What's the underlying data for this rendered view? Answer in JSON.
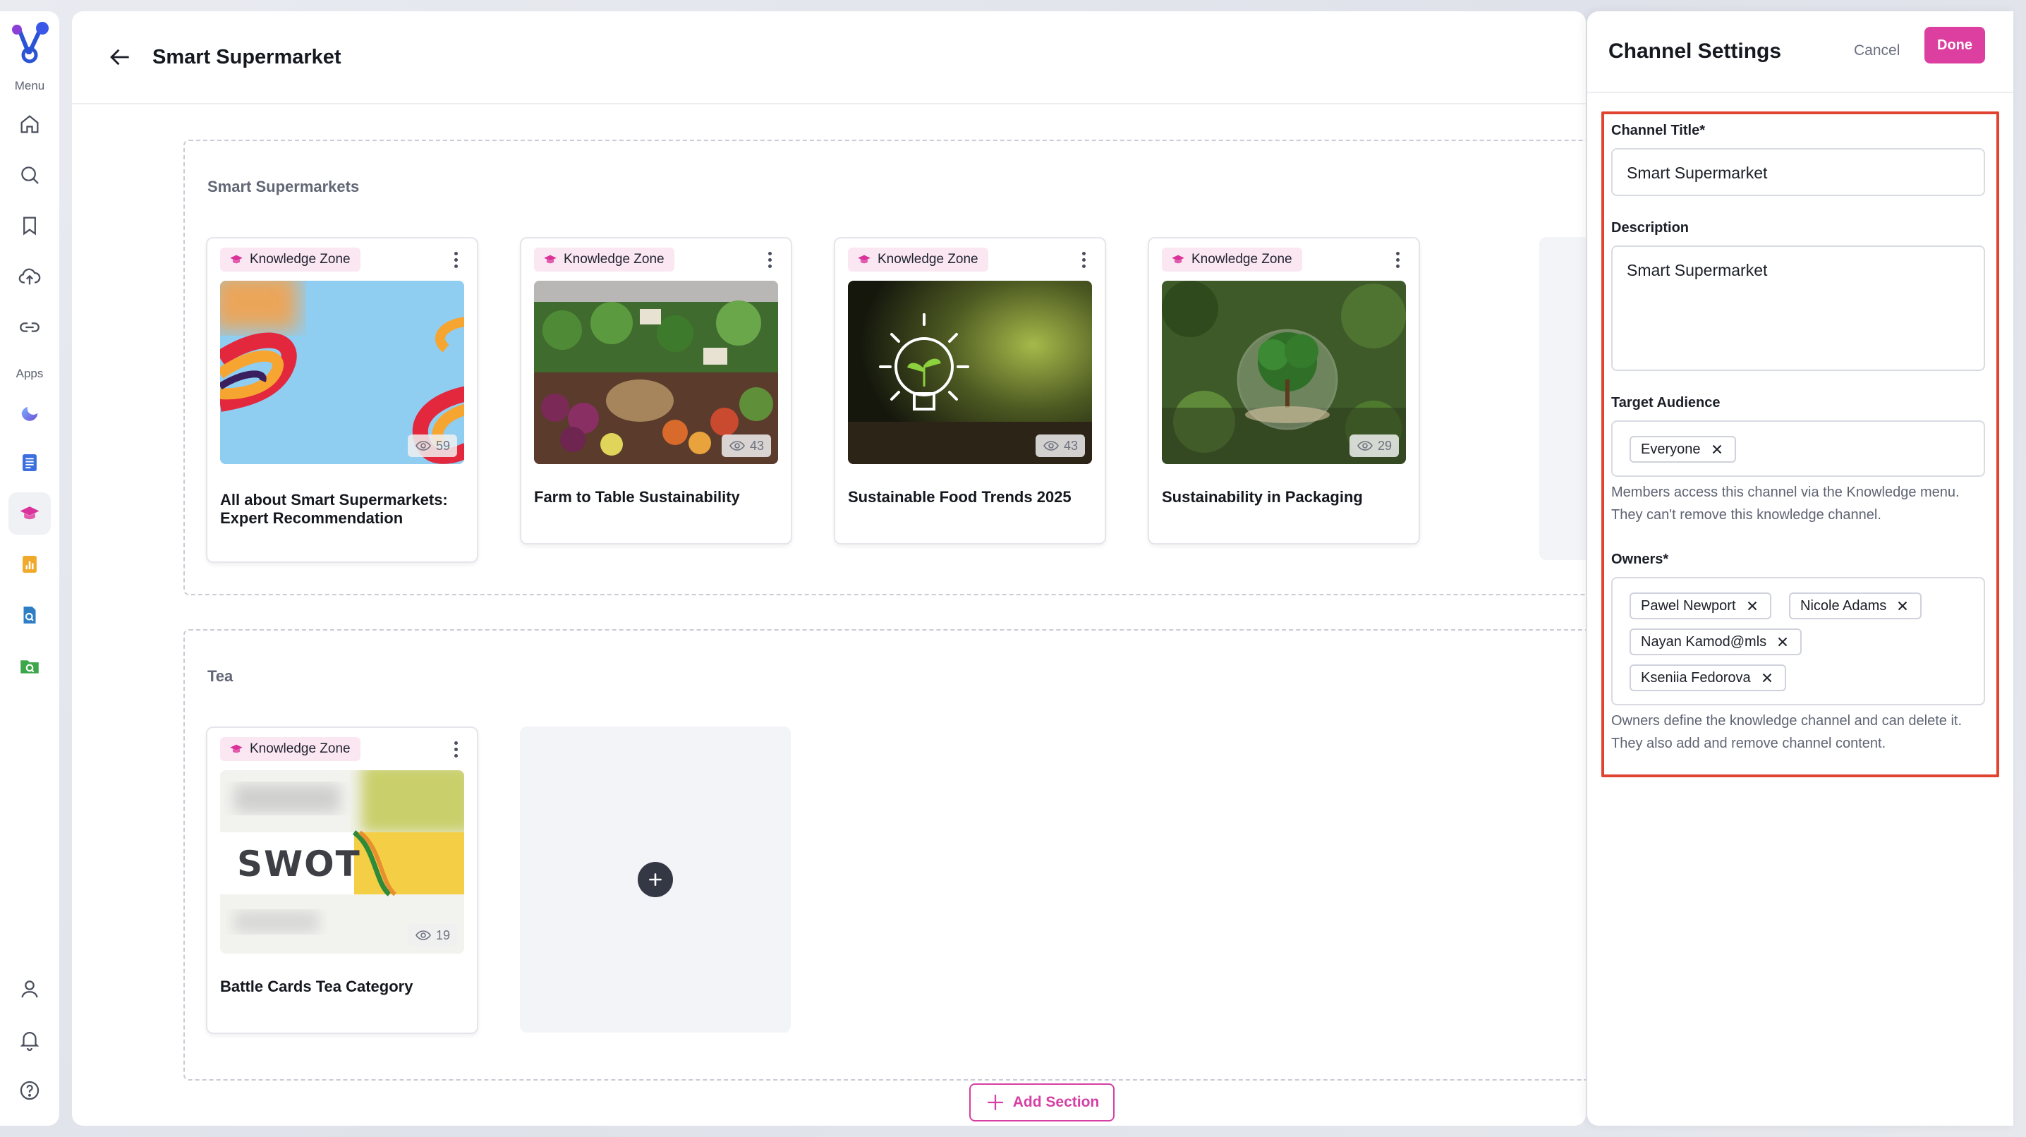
{
  "rail": {
    "menu_label": "Menu",
    "apps_label": "Apps",
    "menu_icons": [
      "home-icon",
      "search-icon",
      "bookmark-icon",
      "upload-icon",
      "link-icon"
    ],
    "app_icons": [
      "crescent-app-icon",
      "document-app-icon",
      "knowledge-app-icon",
      "chart-app-icon",
      "file-search-app-icon",
      "folder-search-app-icon"
    ],
    "bottom_icons": [
      "user-icon",
      "bell-icon",
      "help-icon"
    ]
  },
  "header": {
    "title": "Smart Supermarket"
  },
  "sections": [
    {
      "title": "Smart Supermarkets",
      "cards": [
        {
          "badge": "Knowledge Zone",
          "views": "59",
          "title": "All about Smart Supermarkets: Expert Recommendation"
        },
        {
          "badge": "Knowledge Zone",
          "views": "43",
          "title": "Farm to Table Sustainability"
        },
        {
          "badge": "Knowledge Zone",
          "views": "43",
          "title": "Sustainable Food Trends 2025"
        },
        {
          "badge": "Knowledge Zone",
          "views": "29",
          "title": "Sustainability in Packaging"
        }
      ]
    },
    {
      "title": "Tea",
      "cards": [
        {
          "badge": "Knowledge Zone",
          "views": "19",
          "title": "Battle Cards Tea Category",
          "thumb_text": "SWOT"
        }
      ]
    }
  ],
  "add_section_label": "Add Section",
  "panel": {
    "title": "Channel Settings",
    "cancel_label": "Cancel",
    "done_label": "Done",
    "channel_title_label": "Channel Title*",
    "channel_title_value": "Smart Supermarket",
    "description_label": "Description",
    "description_value": "Smart Supermarket",
    "audience_label": "Target Audience",
    "audience_chips": [
      "Everyone"
    ],
    "audience_help": "Members access this channel via the Knowledge menu. They can't remove this knowledge channel.",
    "owners_label": "Owners*",
    "owners": [
      "Pawel Newport",
      "Nicole Adams",
      "Nayan Kamod@mls",
      "Kseniia Fedorova"
    ],
    "owners_help": "Owners define the knowledge channel and can delete it. They also add and remove channel content."
  },
  "colors": {
    "accent": "#dc3fa0",
    "highlight": "#e0432f",
    "badge_bg": "#fbe7f2"
  }
}
